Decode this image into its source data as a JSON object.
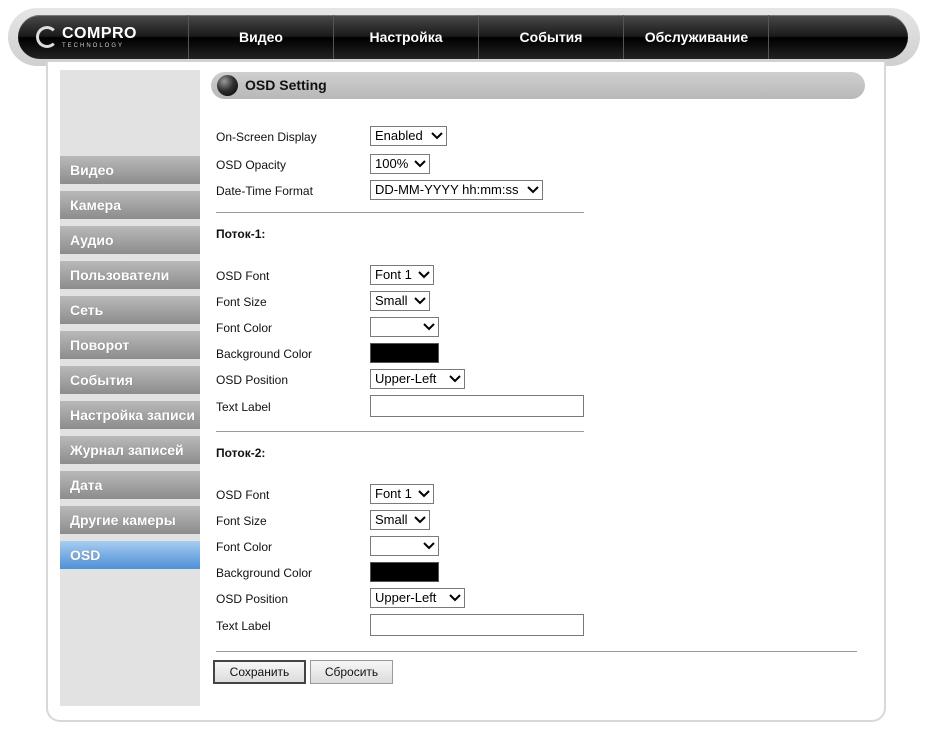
{
  "brand": {
    "logo_main": "COMPRO",
    "logo_sub": "TECHNOLOGY"
  },
  "nav": [
    "Видео",
    "Настройка",
    "События",
    "Обслуживание"
  ],
  "sidebar": {
    "items": [
      "Видео",
      "Камера",
      "Аудио",
      "Пользователи",
      "Сеть",
      "Поворот",
      "События",
      "Настройка записи",
      "Журнал записей",
      "Дата",
      "Другие камеры",
      "OSD"
    ],
    "active": "OSD"
  },
  "section": {
    "title": "OSD Setting"
  },
  "general": {
    "osd_label": "On-Screen Display",
    "osd_value": "Enabled",
    "opacity_label": "OSD Opacity",
    "opacity_value": "100%",
    "datetime_label": "Date-Time Format",
    "datetime_value": "DD-MM-YYYY hh:mm:ss"
  },
  "streams": [
    {
      "title": "Поток-1:",
      "font_label": "OSD Font",
      "font_value": "Font 1",
      "size_label": "Font Size",
      "size_value": "Small",
      "color_label": "Font Color",
      "color_value": "",
      "bg_label": "Background Color",
      "bg_color": "#000000",
      "position_label": "OSD Position",
      "position_value": "Upper-Left",
      "text_label": "Text Label",
      "text_value": ""
    },
    {
      "title": "Поток-2:",
      "font_label": "OSD Font",
      "font_value": "Font 1",
      "size_label": "Font Size",
      "size_value": "Small",
      "color_label": "Font Color",
      "color_value": "",
      "bg_label": "Background Color",
      "bg_color": "#000000",
      "position_label": "OSD Position",
      "position_value": "Upper-Left",
      "text_label": "Text Label",
      "text_value": ""
    }
  ],
  "buttons": {
    "save": "Сохранить",
    "reset": "Сбросить"
  },
  "colors": {
    "active_tab": "#79aee4",
    "sidebar_bg": "#e2e2e2",
    "header_bar": "#c4c4c4"
  }
}
